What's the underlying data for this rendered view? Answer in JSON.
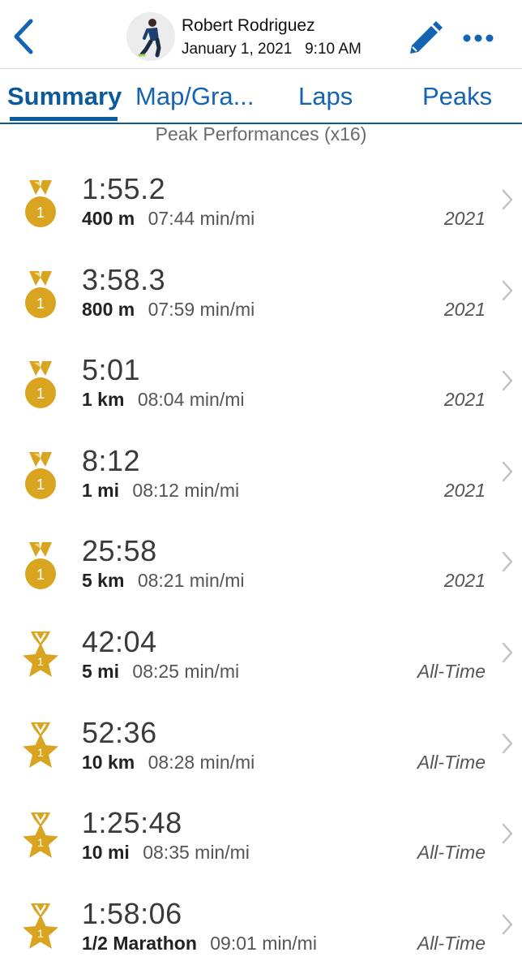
{
  "header": {
    "user_name": "Robert Rodriguez",
    "date": "January 1, 2021",
    "time": "9:10 AM",
    "back_icon": "chevron-left-icon",
    "edit_icon": "pencil-icon",
    "more_icon": "ellipsis-icon"
  },
  "tabs": [
    {
      "label": "Summary",
      "active": true
    },
    {
      "label": "Map/Gra..."
    },
    {
      "label": "Laps"
    },
    {
      "label": "Peaks"
    }
  ],
  "section_title": "Peak Performances (x16)",
  "peaks": [
    {
      "time": "1:55.2",
      "distance": "400 m",
      "pace": "07:44 min/mi",
      "period": "2021",
      "badge": "medal-icon",
      "rank": "1"
    },
    {
      "time": "3:58.3",
      "distance": "800 m",
      "pace": "07:59 min/mi",
      "period": "2021",
      "badge": "medal-icon",
      "rank": "1"
    },
    {
      "time": "5:01",
      "distance": "1 km",
      "pace": "08:04 min/mi",
      "period": "2021",
      "badge": "medal-icon",
      "rank": "1"
    },
    {
      "time": "8:12",
      "distance": "1 mi",
      "pace": "08:12 min/mi",
      "period": "2021",
      "badge": "medal-icon",
      "rank": "1"
    },
    {
      "time": "25:58",
      "distance": "5 km",
      "pace": "08:21 min/mi",
      "period": "2021",
      "badge": "medal-icon",
      "rank": "1"
    },
    {
      "time": "42:04",
      "distance": "5 mi",
      "pace": "08:25 min/mi",
      "period": "All-Time",
      "badge": "star-medal-icon",
      "rank": "1"
    },
    {
      "time": "52:36",
      "distance": "10 km",
      "pace": "08:28 min/mi",
      "period": "All-Time",
      "badge": "star-medal-icon",
      "rank": "1"
    },
    {
      "time": "1:25:48",
      "distance": "10 mi",
      "pace": "08:35 min/mi",
      "period": "All-Time",
      "badge": "star-medal-icon",
      "rank": "1"
    },
    {
      "time": "1:58:06",
      "distance": "1/2 Marathon",
      "pace": "09:01 min/mi",
      "period": "All-Time",
      "badge": "star-medal-icon",
      "rank": "1"
    }
  ],
  "colors": {
    "accent": "#0b5a9c",
    "gold": "#d9a520",
    "tab_text": "#1464b4"
  }
}
